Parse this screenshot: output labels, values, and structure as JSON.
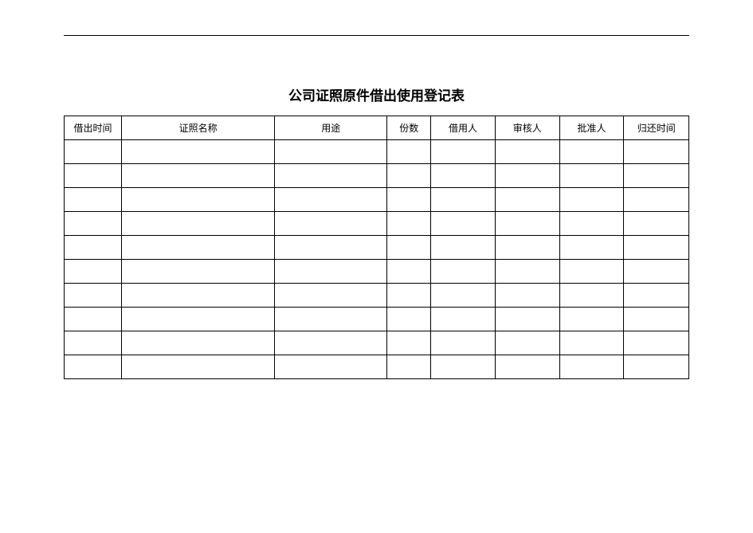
{
  "title": "公司证照原件借出使用登记表",
  "columns": [
    "借出时间",
    "证照名称",
    "用途",
    "份数",
    "借用人",
    "审核人",
    "批准人",
    "归还时间"
  ],
  "rows": [
    [
      "",
      "",
      "",
      "",
      "",
      "",
      "",
      ""
    ],
    [
      "",
      "",
      "",
      "",
      "",
      "",
      "",
      ""
    ],
    [
      "",
      "",
      "",
      "",
      "",
      "",
      "",
      ""
    ],
    [
      "",
      "",
      "",
      "",
      "",
      "",
      "",
      ""
    ],
    [
      "",
      "",
      "",
      "",
      "",
      "",
      "",
      ""
    ],
    [
      "",
      "",
      "",
      "",
      "",
      "",
      "",
      ""
    ],
    [
      "",
      "",
      "",
      "",
      "",
      "",
      "",
      ""
    ],
    [
      "",
      "",
      "",
      "",
      "",
      "",
      "",
      ""
    ],
    [
      "",
      "",
      "",
      "",
      "",
      "",
      "",
      ""
    ],
    [
      "",
      "",
      "",
      "",
      "",
      "",
      "",
      ""
    ]
  ]
}
